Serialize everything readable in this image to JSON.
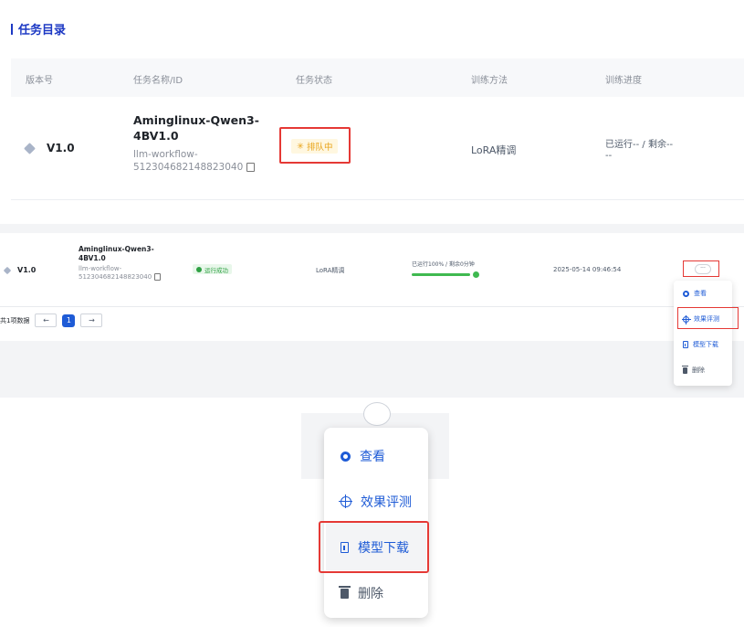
{
  "section_title": "任务目录",
  "table": {
    "headers": [
      "版本号",
      "任务名称/ID",
      "任务状态",
      "训练方法",
      "训练进度"
    ]
  },
  "row_queued": {
    "version": "V1.0",
    "name": "Aminglinux-Qwen3-4BV1.0",
    "id_line1": "llm-workflow-",
    "id_line2": "512304682148823040",
    "status": "排队中",
    "method": "LoRA精调",
    "progress_line1": "已运行-- / 剩余--",
    "progress_line2": "--"
  },
  "row_done": {
    "version": "V1.0",
    "name": "Aminglinux-Qwen3-4BV1.0",
    "id_line1": "llm-workflow-",
    "id_line2": "512304682148823040",
    "status": "运行成功",
    "method": "LoRA精调",
    "progress_text": "已运行100% / 剩余0分钟",
    "progress_fraction": 1.0,
    "time": "2025-05-14 09:46:54",
    "more": "···"
  },
  "pagination": {
    "total": "共1项数据",
    "prev": "←",
    "page": "1",
    "next": "→"
  },
  "menu": {
    "view": "查看",
    "evaluate": "效果评测",
    "download": "模型下载",
    "delete": "删除"
  },
  "colors": {
    "accent": "#1e5bd6",
    "highlight": "#e53935",
    "success": "#2ea043",
    "warning": "#e8a317"
  }
}
